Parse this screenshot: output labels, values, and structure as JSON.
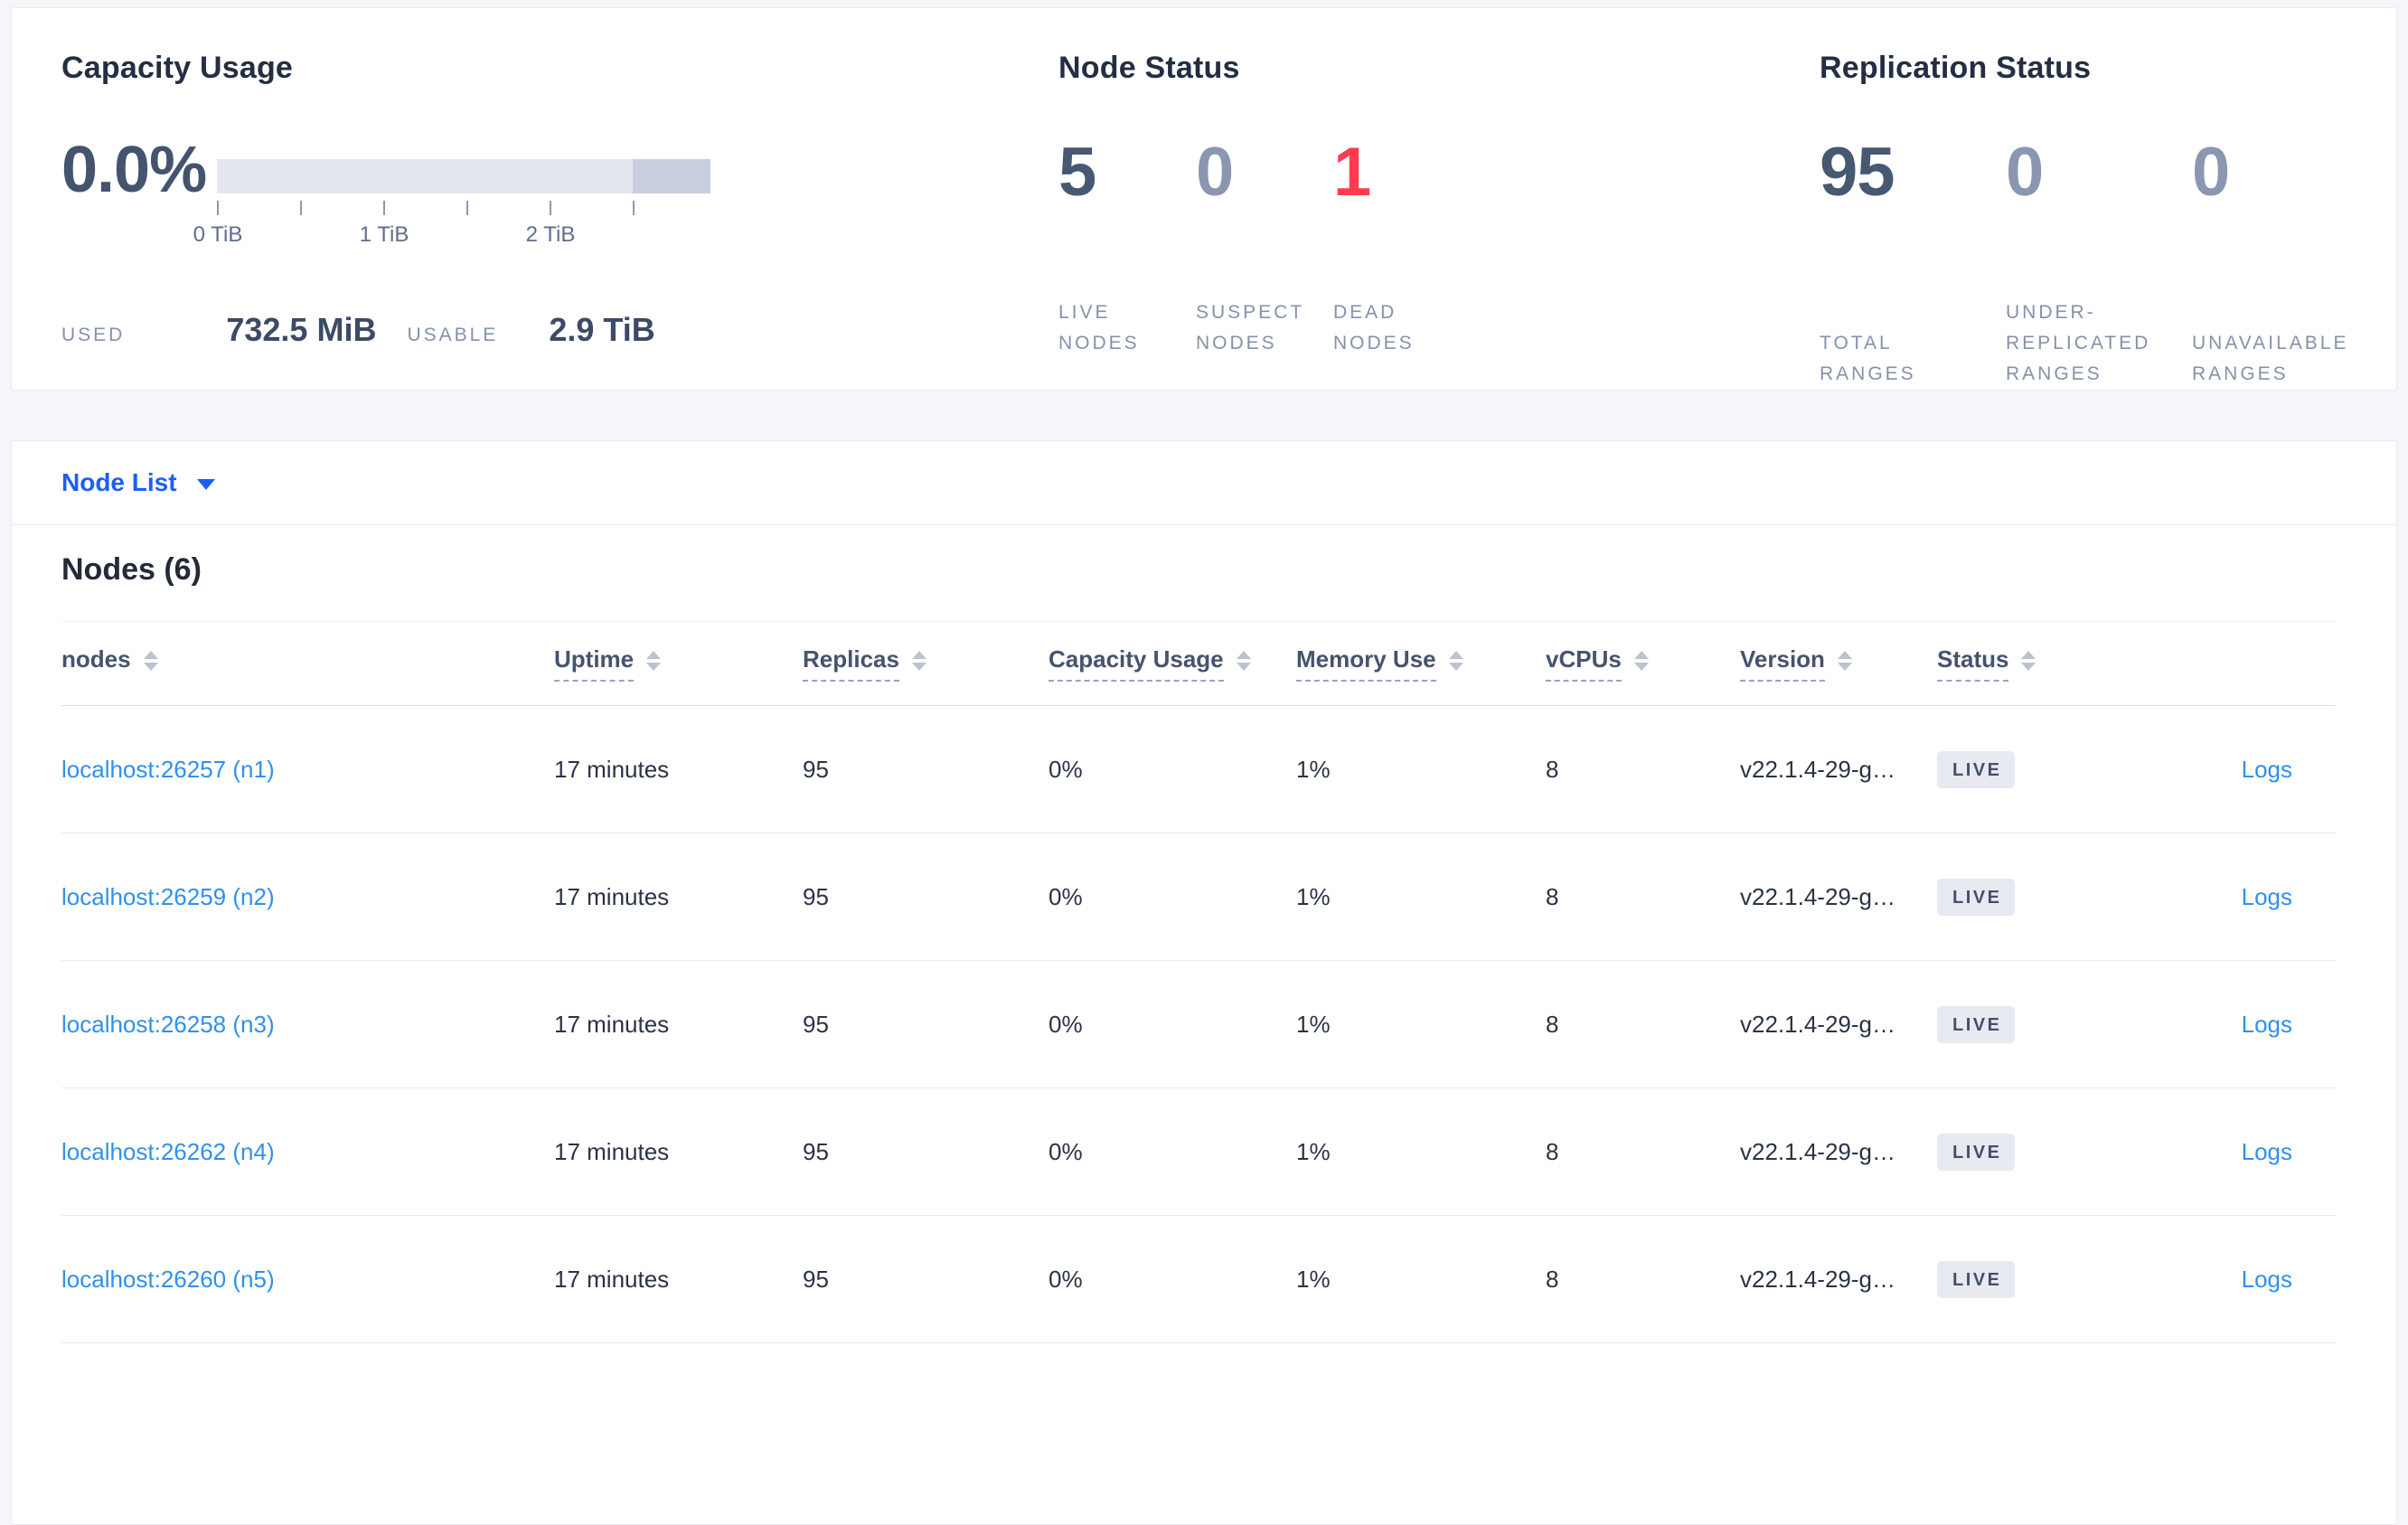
{
  "capacity_panel": {
    "title": "Capacity Usage",
    "percent_used": "0.0%",
    "axis_ticks": [
      "0 TiB",
      "1 TiB",
      "2 TiB"
    ],
    "used_label": "USED",
    "used_value": "732.5 MiB",
    "usable_label": "USABLE",
    "usable_value": "2.9 TiB"
  },
  "node_status_panel": {
    "title": "Node Status",
    "live": {
      "value": "5",
      "label": "LIVE\nNODES"
    },
    "suspect": {
      "value": "0",
      "label": "SUSPECT\nNODES"
    },
    "dead": {
      "value": "1",
      "label": "DEAD\nNODES"
    }
  },
  "replication_panel": {
    "title": "Replication Status",
    "total": {
      "value": "95",
      "label": "TOTAL\nRANGES"
    },
    "under_replicated": {
      "value": "0",
      "label": "UNDER-\nREPLICATED\nRANGES"
    },
    "unavailable": {
      "value": "0",
      "label": "UNAVAILABLE\nRANGES"
    }
  },
  "view_selector": {
    "label": "Node List"
  },
  "nodes_table": {
    "title": "Nodes (6)",
    "columns": {
      "nodes": "nodes",
      "uptime": "Uptime",
      "replicas": "Replicas",
      "capacity": "Capacity Usage",
      "memory": "Memory Use",
      "vcpus": "vCPUs",
      "version": "Version",
      "status": "Status"
    },
    "rows": [
      {
        "node": "localhost:26257 (n1)",
        "uptime": "17 minutes",
        "replicas": "95",
        "capacity": "0%",
        "memory": "1%",
        "vcpus": "8",
        "version": "v22.1.4-29-g…",
        "status": "LIVE",
        "logs": "Logs"
      },
      {
        "node": "localhost:26259 (n2)",
        "uptime": "17 minutes",
        "replicas": "95",
        "capacity": "0%",
        "memory": "1%",
        "vcpus": "8",
        "version": "v22.1.4-29-g…",
        "status": "LIVE",
        "logs": "Logs"
      },
      {
        "node": "localhost:26258 (n3)",
        "uptime": "17 minutes",
        "replicas": "95",
        "capacity": "0%",
        "memory": "1%",
        "vcpus": "8",
        "version": "v22.1.4-29-g…",
        "status": "LIVE",
        "logs": "Logs"
      },
      {
        "node": "localhost:26262 (n4)",
        "uptime": "17 minutes",
        "replicas": "95",
        "capacity": "0%",
        "memory": "1%",
        "vcpus": "8",
        "version": "v22.1.4-29-g…",
        "status": "LIVE",
        "logs": "Logs"
      },
      {
        "node": "localhost:26260 (n5)",
        "uptime": "17 minutes",
        "replicas": "95",
        "capacity": "0%",
        "memory": "1%",
        "vcpus": "8",
        "version": "v22.1.4-29-g…",
        "status": "LIVE",
        "logs": "Logs"
      }
    ]
  },
  "colors": {
    "selector_blue": "#1b5ff7",
    "link_blue": "#2f90ee",
    "dead_red": "#ff3b4e",
    "number_dark": "#475872",
    "number_muted": "#8b96b0",
    "bar_light": "#e5e7f0",
    "bar_reserved": "#cacfdd",
    "badge_bg": "#e7eaf1"
  }
}
